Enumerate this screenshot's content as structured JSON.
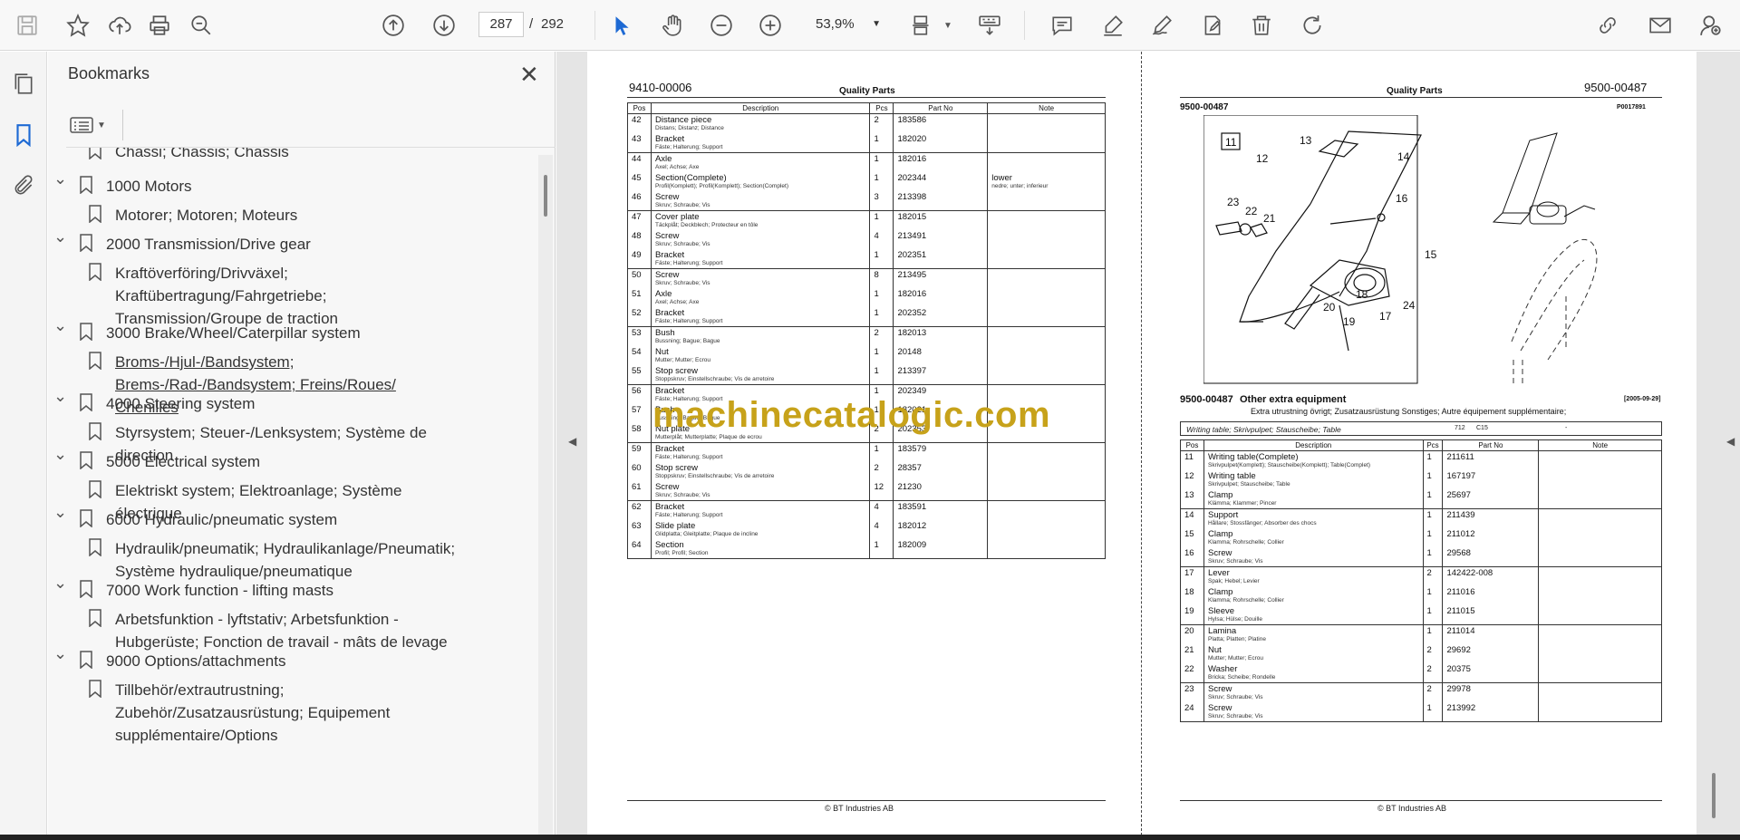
{
  "toolbar": {
    "page_current": "287",
    "page_separator": "/",
    "page_total": "292",
    "zoom": "53,9%"
  },
  "bookmarks": {
    "title": "Bookmarks",
    "items": [
      {
        "label": "Chassi; Chassis; Chassis",
        "level": 2
      },
      {
        "label": "1000 Motors",
        "level": 1
      },
      {
        "label": "Motorer; Motoren; Moteurs",
        "level": 2
      },
      {
        "label": "2000 Transmission/Drive gear",
        "level": 1
      },
      {
        "label": "Kraftöverföring/Drivväxel; Kraftübertragung/Fahrgetriebe; Transmission/Groupe de traction",
        "level": 2
      },
      {
        "label": "3000 Brake/Wheel/Caterpillar system",
        "level": 1
      },
      {
        "label": "Broms-/Hjul-/Bandsystem; Brems-/Rad-/Bandsystem; Freins/Roues/ Chenilles",
        "level": 2
      },
      {
        "label": "4000 Steering system",
        "level": 1
      },
      {
        "label": "Styrsystem; Steuer-/Lenksystem; Système de direction",
        "level": 2
      },
      {
        "label": "5000 Electrical system",
        "level": 1
      },
      {
        "label": "Elektriskt system; Elektroanlage; Système électrique",
        "level": 2
      },
      {
        "label": "6000 Hydraulic/pneumatic system",
        "level": 1
      },
      {
        "label": "Hydraulik/pneumatik; Hydraulikanlage/Pneumatik; Système hydraulique/pneumatique",
        "level": 2
      },
      {
        "label": "7000 Work function - lifting masts",
        "level": 1
      },
      {
        "label": "Arbetsfunktion - lyftstativ; Arbetsfunktion - Hubgerüste; Fonction de travail - mâts de levage",
        "level": 2
      },
      {
        "label": "9000 Options/attachments",
        "level": 1
      },
      {
        "label": "Tillbehör/extrautrustning; Zubehör/Zusatzausrüstung; Equipement supplémentaire/Options",
        "level": 2
      }
    ]
  },
  "left_page": {
    "doc_number": "9410-00006",
    "title": "Quality Parts",
    "columns": [
      "Pos",
      "Description",
      "Pcs",
      "Part No",
      "Note"
    ],
    "footer": "© BT Industries AB",
    "rows": [
      {
        "pos": "42",
        "desc": "Distance piece",
        "sub": "Distans; Distanz; Distance",
        "pcs": "2",
        "part": "183586",
        "note": "",
        "note_sub": "",
        "group": true
      },
      {
        "pos": "43",
        "desc": "Bracket",
        "sub": "Fäste; Halterung; Support",
        "pcs": "1",
        "part": "182020",
        "note": "",
        "note_sub": "",
        "group": false
      },
      {
        "pos": "44",
        "desc": "Axle",
        "sub": "Axel; Achse; Axe",
        "pcs": "1",
        "part": "182016",
        "note": "",
        "note_sub": "",
        "group": true
      },
      {
        "pos": "45",
        "desc": "Section(Complete)",
        "sub": "Profil(Komplett); Profil(Komplett); Section(Complet)",
        "pcs": "1",
        "part": "202344",
        "note": "lower",
        "note_sub": "nedre; unter; inferieur",
        "group": false
      },
      {
        "pos": "46",
        "desc": "Screw",
        "sub": "Skruv; Schraube; Vis",
        "pcs": "3",
        "part": "213398",
        "note": "",
        "note_sub": "",
        "group": false
      },
      {
        "pos": "47",
        "desc": "Cover plate",
        "sub": "Täckplåt; Deckblech; Protecteur en tôle",
        "pcs": "1",
        "part": "182015",
        "note": "",
        "note_sub": "",
        "group": true
      },
      {
        "pos": "48",
        "desc": "Screw",
        "sub": "Skruv; Schraube; Vis",
        "pcs": "4",
        "part": "213491",
        "note": "",
        "note_sub": "",
        "group": false
      },
      {
        "pos": "49",
        "desc": "Bracket",
        "sub": "Fäste; Halterung; Support",
        "pcs": "1",
        "part": "202351",
        "note": "",
        "note_sub": "",
        "group": false
      },
      {
        "pos": "50",
        "desc": "Screw",
        "sub": "Skruv; Schraube; Vis",
        "pcs": "8",
        "part": "213495",
        "note": "",
        "note_sub": "",
        "group": true
      },
      {
        "pos": "51",
        "desc": "Axle",
        "sub": "Axel; Achse; Axe",
        "pcs": "1",
        "part": "182016",
        "note": "",
        "note_sub": "",
        "group": false
      },
      {
        "pos": "52",
        "desc": "Bracket",
        "sub": "Fäste; Halterung; Support",
        "pcs": "1",
        "part": "202352",
        "note": "",
        "note_sub": "",
        "group": false
      },
      {
        "pos": "53",
        "desc": "Bush",
        "sub": "Bussning; Bague; Bague",
        "pcs": "2",
        "part": "182013",
        "note": "",
        "note_sub": "",
        "group": true
      },
      {
        "pos": "54",
        "desc": "Nut",
        "sub": "Mutter; Mutter; Ecrou",
        "pcs": "1",
        "part": "20148",
        "note": "",
        "note_sub": "",
        "group": false
      },
      {
        "pos": "55",
        "desc": "Stop screw",
        "sub": "Stoppskruv; Einstellschraube; Vis de arretoire",
        "pcs": "1",
        "part": "213397",
        "note": "",
        "note_sub": "",
        "group": false
      },
      {
        "pos": "56",
        "desc": "Bracket",
        "sub": "Fäste; Halterung; Support",
        "pcs": "1",
        "part": "202349",
        "note": "",
        "note_sub": "",
        "group": true
      },
      {
        "pos": "57",
        "desc": "Bush",
        "sub": "Bussning; Bague; Bague",
        "pcs": "1",
        "part": "182021",
        "note": "",
        "note_sub": "",
        "group": false
      },
      {
        "pos": "58",
        "desc": "Nut plate",
        "sub": "Mutterplåt; Mutterplatte; Plaque de ecrou",
        "pcs": "2",
        "part": "202353",
        "note": "",
        "note_sub": "",
        "group": false
      },
      {
        "pos": "59",
        "desc": "Bracket",
        "sub": "Fäste; Halterung; Support",
        "pcs": "1",
        "part": "183579",
        "note": "",
        "note_sub": "",
        "group": true
      },
      {
        "pos": "60",
        "desc": "Stop screw",
        "sub": "Stoppskruv; Einstellschraube; Vis de arretoire",
        "pcs": "2",
        "part": "28357",
        "note": "",
        "note_sub": "",
        "group": false
      },
      {
        "pos": "61",
        "desc": "Screw",
        "sub": "Skruv; Schraube; Vis",
        "pcs": "12",
        "part": "21230",
        "note": "",
        "note_sub": "",
        "group": false
      },
      {
        "pos": "62",
        "desc": "Bracket",
        "sub": "Fäste; Halterung; Support",
        "pcs": "4",
        "part": "183591",
        "note": "",
        "note_sub": "",
        "group": true
      },
      {
        "pos": "63",
        "desc": "Slide plate",
        "sub": "Glidplatta; Gleitplatte; Plaque de incline",
        "pcs": "4",
        "part": "182012",
        "note": "",
        "note_sub": "",
        "group": false
      },
      {
        "pos": "64",
        "desc": "Section",
        "sub": "Profil; Profil; Section",
        "pcs": "1",
        "part": "182009",
        "note": "",
        "note_sub": "",
        "group": false
      }
    ]
  },
  "right_page": {
    "doc_number": "9500-00487",
    "title": "Quality Parts",
    "doc_number_small": "9500-00487",
    "image_ref": "P0017891",
    "figure_box_label": "11",
    "callouts": [
      "12",
      "13",
      "14",
      "15",
      "16",
      "17",
      "18",
      "19",
      "20",
      "21",
      "22",
      "23",
      "24"
    ],
    "section_number": "9500-00487",
    "section_title": "Other extra equipment",
    "section_date": "[2005-09-29]",
    "section_sub": "Extra utrustning övrigt; Zusatzausrüstung Sonstiges; Autre équipement supplémentaire;",
    "variant_label": "Writing table; Skrivpulpet; Stauscheibe; Table",
    "variant_code1": "712",
    "variant_code2": "C15",
    "variant_dash": "-",
    "columns": [
      "Pos",
      "Description",
      "Pcs",
      "Part No",
      "Note"
    ],
    "footer": "© BT Industries AB",
    "rows": [
      {
        "pos": "11",
        "desc": "Writing table(Complete)",
        "sub": "Skrivpulpet(Komplett); Stauscheibe(Komplett); Table(Complet)",
        "pcs": "1",
        "part": "211611",
        "group": true
      },
      {
        "pos": "12",
        "desc": "Writing table",
        "sub": "Skrivpulpet; Stauscheibe; Table",
        "pcs": "1",
        "part": "167197",
        "group": false
      },
      {
        "pos": "13",
        "desc": "Clamp",
        "sub": "Klämma; Klammer; Pincer",
        "pcs": "1",
        "part": "25697",
        "group": false
      },
      {
        "pos": "14",
        "desc": "Support",
        "sub": "Hållare; Stossfänger; Absorber des chocs",
        "pcs": "1",
        "part": "211439",
        "group": true
      },
      {
        "pos": "15",
        "desc": "Clamp",
        "sub": "Klamma; Rohrschelle; Collier",
        "pcs": "1",
        "part": "211012",
        "group": false
      },
      {
        "pos": "16",
        "desc": "Screw",
        "sub": "Skruv; Schraube; Vis",
        "pcs": "1",
        "part": "29568",
        "group": false
      },
      {
        "pos": "17",
        "desc": "Lever",
        "sub": "Spak; Hebel; Levier",
        "pcs": "2",
        "part": "142422-008",
        "group": true
      },
      {
        "pos": "18",
        "desc": "Clamp",
        "sub": "Klamma; Rohrschelle; Collier",
        "pcs": "1",
        "part": "211016",
        "group": false
      },
      {
        "pos": "19",
        "desc": "Sleeve",
        "sub": "Hylsa; Hülse; Douille",
        "pcs": "1",
        "part": "211015",
        "group": false
      },
      {
        "pos": "20",
        "desc": "Lamina",
        "sub": "Platta; Platten; Platine",
        "pcs": "1",
        "part": "211014",
        "group": true
      },
      {
        "pos": "21",
        "desc": "Nut",
        "sub": "Mutter; Mutter; Ecrou",
        "pcs": "2",
        "part": "29692",
        "group": false
      },
      {
        "pos": "22",
        "desc": "Washer",
        "sub": "Bricka; Scheibe; Rondelle",
        "pcs": "2",
        "part": "20375",
        "group": false
      },
      {
        "pos": "23",
        "desc": "Screw",
        "sub": "Skruv; Schraube; Vis",
        "pcs": "2",
        "part": "29978",
        "group": true
      },
      {
        "pos": "24",
        "desc": "Screw",
        "sub": "Skruv; Schraube; Vis",
        "pcs": "1",
        "part": "213992",
        "group": false
      }
    ]
  },
  "watermark": "machinecatalogic.com"
}
